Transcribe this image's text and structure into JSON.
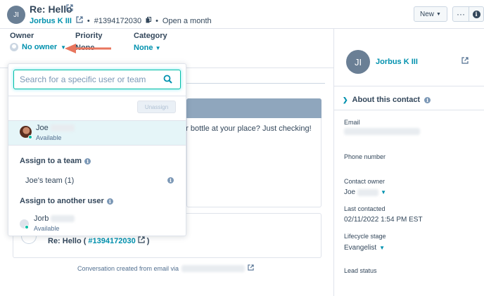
{
  "header": {
    "avatar_initials": "JI",
    "title": "Re: Hello",
    "contact_link": "Jorbus K III",
    "ticket_id": "#1394172030",
    "status": "Open a month",
    "new_button": "New",
    "more_button": "···"
  },
  "properties": {
    "owner_label": "Owner",
    "owner_value": "No owner",
    "priority_label": "Priority",
    "priority_value": "None",
    "category_label": "Category",
    "category_value": "None"
  },
  "dropdown": {
    "search_placeholder": "Search for a specific user or team",
    "unassign_label": "Unassign",
    "selected_user": {
      "name": "Joe",
      "status": "Available"
    },
    "team_heading": "Assign to a team",
    "team_item": "Joe's team (1)",
    "another_heading": "Assign to another user",
    "other_user": {
      "name": "Jorb",
      "status": "Available"
    }
  },
  "conversation": {
    "message_fragment": "er bottle at your place? Just checking!",
    "thread_title": "Re: Hello (",
    "thread_id": "#1394172030",
    "thread_close": ")",
    "created_text": "Conversation created from email via"
  },
  "contact_panel": {
    "avatar_initials": "JI",
    "name": "Jorbus K III",
    "section_title": "About this contact",
    "email_label": "Email",
    "phone_label": "Phone number",
    "contact_owner_label": "Contact owner",
    "contact_owner_value": "Joe",
    "last_contacted_label": "Last contacted",
    "last_contacted_value": "02/11/2022 1:54 PM EST",
    "lifecycle_label": "Lifecycle stage",
    "lifecycle_value": "Evangelist",
    "lead_status_label": "Lead status"
  },
  "colors": {
    "link": "#0091ae",
    "text": "#33475b",
    "annotation_arrow": "#e8765e",
    "search_focus": "#00bda5",
    "available_dot": "#00bda5"
  }
}
